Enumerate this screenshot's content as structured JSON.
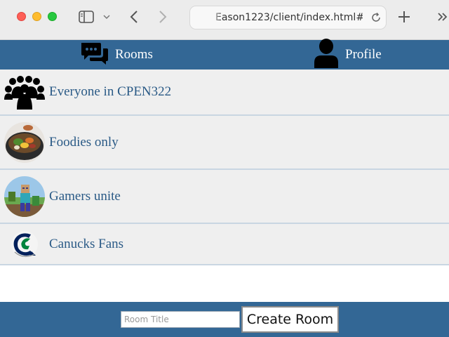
{
  "browser": {
    "url": "Eason1223/client/index.html#/"
  },
  "nav": {
    "rooms_label": "Rooms",
    "profile_label": "Profile"
  },
  "rooms": [
    {
      "name": "Everyone in CPEN322",
      "icon": "group-icon"
    },
    {
      "name": "Foodies only",
      "icon": "food-bowl-image"
    },
    {
      "name": "Gamers unite",
      "icon": "minecraft-image"
    },
    {
      "name": "Canucks Fans",
      "icon": "canucks-logo"
    }
  ],
  "footer": {
    "room_title_placeholder": "Room Title",
    "create_button_label": "Create Room"
  },
  "colors": {
    "nav_bg": "#336795",
    "room_bg": "#efefef",
    "room_text": "#2a5a86"
  }
}
